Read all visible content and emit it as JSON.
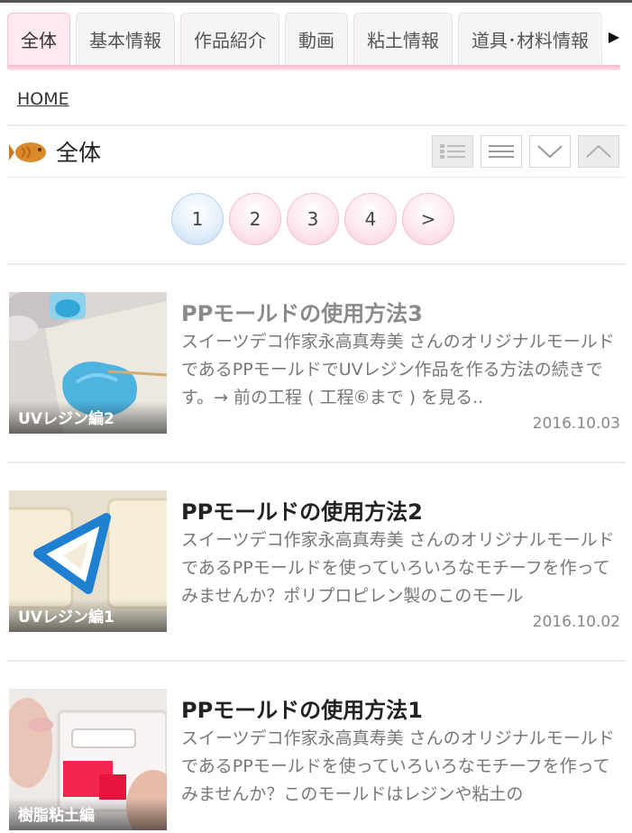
{
  "tabs": [
    "全体",
    "基本情報",
    "作品紹介",
    "動画",
    "粘土情報",
    "道具･材料情報"
  ],
  "breadcrumb": "HOME",
  "section_title": "全体",
  "pagination": {
    "pages": [
      "1",
      "2",
      "3",
      "4"
    ],
    "next": ">",
    "current": "1"
  },
  "articles": [
    {
      "title": "PPモールドの使用方法3",
      "excerpt": "スイーツデコ作家永高真寿美 さんのオリジナルモールドであるPPモールドでUVレジン作品を作る方法の続きです。→ 前の工程 ( 工程⑥まで ) を見る..",
      "date": "2016.10.03",
      "thumb_label": "UVレジン編2",
      "visited": true
    },
    {
      "title": "PPモールドの使用方法2",
      "excerpt": "スイーツデコ作家永高真寿美 さんのオリジナルモールドであるPPモールドを使っていろいろなモチーフを作ってみませんか？ポリプロピレン製のこのモール",
      "date": "2016.10.02",
      "thumb_label": "UVレジン編1",
      "visited": false
    },
    {
      "title": "PPモールドの使用方法1",
      "excerpt": "スイーツデコ作家永高真寿美 さんのオリジナルモールドであるPPモールドを使っていろいろなモチーフを作ってみませんか？このモールドはレジンや粘土の",
      "date": "",
      "thumb_label": "樹脂粘土編",
      "visited": false
    }
  ],
  "colors": {
    "tab_accent": "#f7b9cb",
    "page_bubble": "#fde8ee",
    "page_current": "#e4f0fb"
  }
}
